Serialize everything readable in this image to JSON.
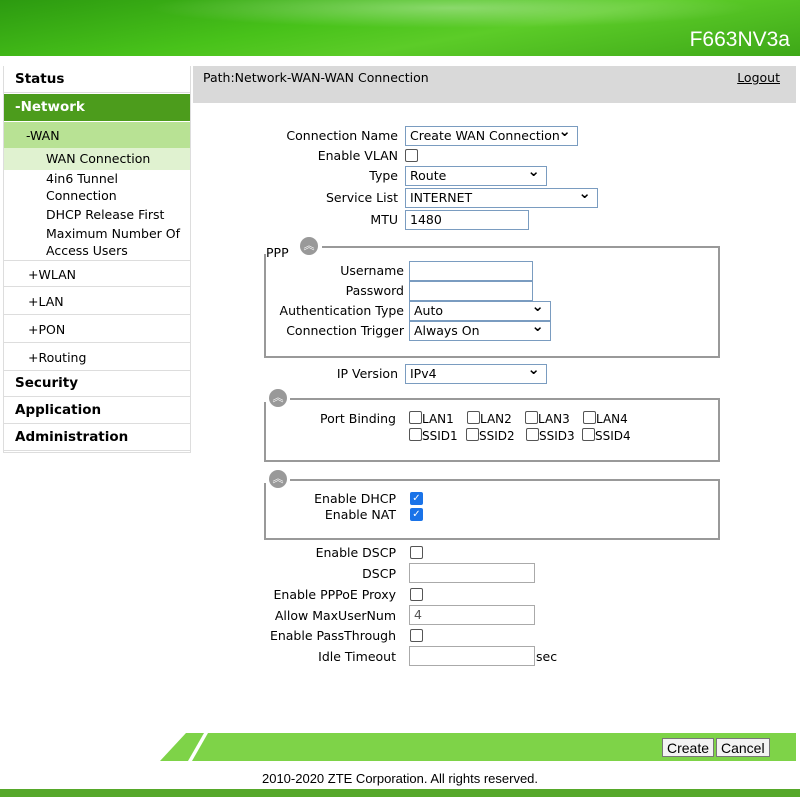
{
  "header": {
    "model": "F663NV3a"
  },
  "sidebar": {
    "status": "Status",
    "network": "-Network",
    "wan": "-WAN",
    "wan_connection": "WAN Connection",
    "tunnel": "4in6 Tunnel Connection",
    "dhcp_release": "DHCP Release First",
    "max_users": "Maximum Number Of Access Users",
    "wlan": "+WLAN",
    "lan": "+LAN",
    "pon": "+PON",
    "routing": "+Routing",
    "security": "Security",
    "application": "Application",
    "administration": "Administration"
  },
  "path": {
    "text": "Path:Network-WAN-WAN Connection",
    "logout": "Logout"
  },
  "form": {
    "connection_name": {
      "label": "Connection Name",
      "value": "Create WAN Connection"
    },
    "enable_vlan": {
      "label": "Enable VLAN",
      "checked": false
    },
    "type": {
      "label": "Type",
      "value": "Route"
    },
    "service_list": {
      "label": "Service List",
      "value": "INTERNET"
    },
    "mtu": {
      "label": "MTU",
      "value": "1480"
    },
    "ppp": {
      "legend": "PPP",
      "username": {
        "label": "Username",
        "value": ""
      },
      "password": {
        "label": "Password",
        "value": ""
      },
      "auth_type": {
        "label": "Authentication Type",
        "value": "Auto"
      },
      "conn_trigger": {
        "label": "Connection Trigger",
        "value": "Always On"
      }
    },
    "ip_version": {
      "label": "IP Version",
      "value": "IPv4"
    },
    "port_binding": {
      "label": "Port Binding",
      "ports": [
        "LAN1",
        "LAN2",
        "LAN3",
        "LAN4",
        "SSID1",
        "SSID2",
        "SSID3",
        "SSID4"
      ]
    },
    "enable_dhcp": {
      "label": "Enable DHCP",
      "checked": true
    },
    "enable_nat": {
      "label": "Enable NAT",
      "checked": true
    },
    "enable_dscp": {
      "label": "Enable DSCP",
      "checked": false
    },
    "dscp": {
      "label": "DSCP",
      "value": ""
    },
    "pppoe_proxy": {
      "label": "Enable PPPoE Proxy",
      "checked": false
    },
    "max_user_num": {
      "label": "Allow MaxUserNum",
      "value": "4"
    },
    "passthrough": {
      "label": "Enable PassThrough",
      "checked": false
    },
    "idle_timeout": {
      "label": "Idle Timeout",
      "value": "",
      "unit": "sec"
    }
  },
  "buttons": {
    "create": "Create",
    "cancel": "Cancel"
  },
  "footer": {
    "copyright": "2010-2020 ZTE Corporation. All rights reserved."
  },
  "colors": {
    "network_bg": "#4c9c1c",
    "wan_bg": "#b8e294",
    "selected_bg": "#e0f2d0",
    "footer_bar": "#7ed348"
  }
}
